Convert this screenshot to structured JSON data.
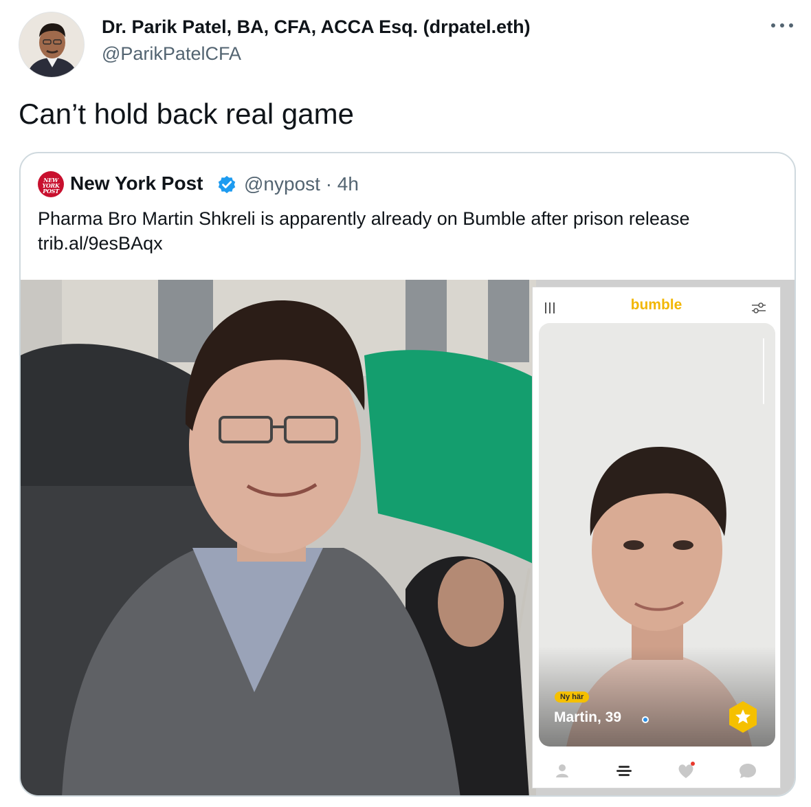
{
  "tweet": {
    "author_name": "Dr. Parik Patel, BA, CFA, ACCA Esq. (drpatel.eth)",
    "author_handle": "@ParikPatelCFA",
    "text": "Can’t hold back real game",
    "more_icon": "more-horizontal-icon"
  },
  "quoted_tweet": {
    "logo_text": "NEW YORK POST",
    "author_name": "New York Post",
    "verified_icon": "verified-badge-icon",
    "handle_time": "@nypost · 4h",
    "text_lines": [
      "Pharma Bro Martin Shkreli is apparently already on Bumble after prison release",
      "trib.al/9esBAqx"
    ]
  },
  "bumble_screen": {
    "app_logo": "bumble",
    "badge": "Ny här",
    "profile_name": "Martin, 39",
    "tabs": [
      "profile-icon",
      "menu-icon",
      "heart-icon",
      "chat-icon"
    ]
  },
  "colors": {
    "text_primary": "#0f1419",
    "text_secondary": "#536471",
    "border": "#cfd9de",
    "nypost_red": "#c8102e",
    "verified_blue": "#1d9bf0",
    "bumble_yellow": "#f5c000"
  }
}
